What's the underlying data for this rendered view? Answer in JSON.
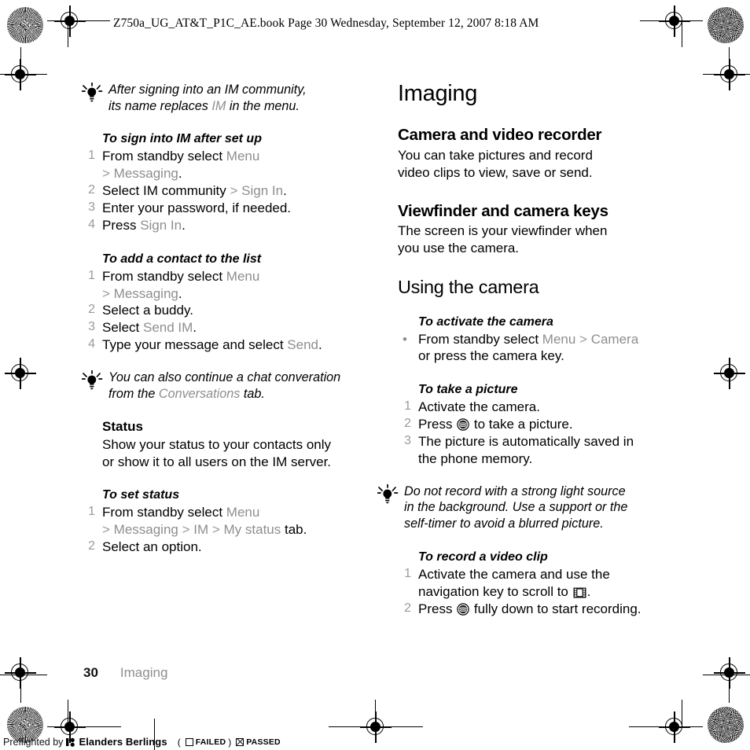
{
  "book_header": "Z750a_UG_AT&T_P1C_AE.book  Page 30  Wednesday, September 12, 2007  8:18 AM",
  "left_column": {
    "tip_1": {
      "icon": "lightbulb-icon",
      "line1_a": "After signing into an IM community,",
      "line2_a": "its name replaces ",
      "line2_menu": "IM",
      "line2_b": " in the menu."
    },
    "proc_sign_in": {
      "title": "To sign into IM after set up",
      "steps": [
        {
          "num": "1",
          "a": "From standby select ",
          "menu1": "Menu",
          "cont_gt": ">",
          "cont_menu": " Messaging",
          "cont_end": "."
        },
        {
          "num": "2",
          "a": "Select IM community ",
          "gt": ">",
          "menu1": " Sign In",
          "b": "."
        },
        {
          "num": "3",
          "a": "Enter your password, if needed."
        },
        {
          "num": "4",
          "a": "Press ",
          "menu1": "Sign In",
          "b": "."
        }
      ]
    },
    "proc_add_contact": {
      "title": "To add a contact to the list",
      "steps": [
        {
          "num": "1",
          "a": "From standby select ",
          "menu1": "Menu",
          "cont_gt": ">",
          "cont_menu": " Messaging",
          "cont_end": "."
        },
        {
          "num": "2",
          "a": "Select a buddy."
        },
        {
          "num": "3",
          "a": "Select ",
          "menu1": "Send IM",
          "b": "."
        },
        {
          "num": "4",
          "a": "Type your message and select ",
          "menu1": "Send",
          "b": "."
        }
      ]
    },
    "tip_2": {
      "icon": "lightbulb-icon",
      "line1_a": "You can also continue a chat converation",
      "line2_a": "from the ",
      "line2_menu": "Conversations",
      "line2_b": " tab."
    },
    "status_section": {
      "heading": "Status",
      "body_line1": "Show your status to your contacts only",
      "body_line2": "or show it to all users on the IM server."
    },
    "proc_set_status": {
      "title": "To set status",
      "steps": [
        {
          "num": "1",
          "a": "From standby select ",
          "menu1": "Menu",
          "cont_gt": ">",
          "cont_menu": " Messaging",
          "cont_gt2": " > ",
          "cont_menu2": "IM",
          "cont_gt3": " > ",
          "cont_menu3": "My status",
          "cont_end": " tab."
        },
        {
          "num": "2",
          "a": "Select an option."
        }
      ]
    }
  },
  "right_column": {
    "chapter_title": "Imaging",
    "section_camera": {
      "heading": "Camera and video recorder",
      "body_line1": "You can take pictures and record",
      "body_line2": "video clips to view, save or send."
    },
    "section_viewfinder": {
      "heading": "Viewfinder and camera keys",
      "body_line1": "The screen is your viewfinder when",
      "body_line2": "you use the camera."
    },
    "section_using_camera": {
      "heading": "Using the camera"
    },
    "proc_activate": {
      "title": "To activate the camera",
      "bullet": "•",
      "a": "From standby select ",
      "menu1": "Menu",
      "gt": " > ",
      "menu2": "Camera",
      "line2": "or press the camera key."
    },
    "proc_take_picture": {
      "title": "To take a picture",
      "steps": [
        {
          "num": "1",
          "a": "Activate the camera."
        },
        {
          "num": "2",
          "a": "Press ",
          "icon": "camera-key-icon",
          "b": " to take a picture."
        },
        {
          "num": "3",
          "a": "The picture is automatically saved in",
          "cont": "the phone memory."
        }
      ]
    },
    "tip_3": {
      "icon": "lightbulb-icon",
      "line1": "Do not record with a strong light source",
      "line2": "in the background. Use a support or the",
      "line3": "self-timer to avoid a blurred picture."
    },
    "proc_record_video": {
      "title": "To record a video clip",
      "steps": [
        {
          "num": "1",
          "a": "Activate the camera and use the",
          "cont_a": "navigation key to scroll to ",
          "icon": "video-clip-icon",
          "cont_b": "."
        },
        {
          "num": "2",
          "a": "Press ",
          "icon": "camera-key-icon",
          "b": " fully down to start recording."
        }
      ]
    }
  },
  "footer": {
    "page_number": "30",
    "page_title": "Imaging"
  },
  "preflight": {
    "by_text": "Preflighted by",
    "logo": "elanders-logo-icon",
    "brand": "Elanders Berlings",
    "paren_open": "(",
    "failed_label": "FAILED",
    "paren_close": ")",
    "passed_label": "PASSED"
  }
}
